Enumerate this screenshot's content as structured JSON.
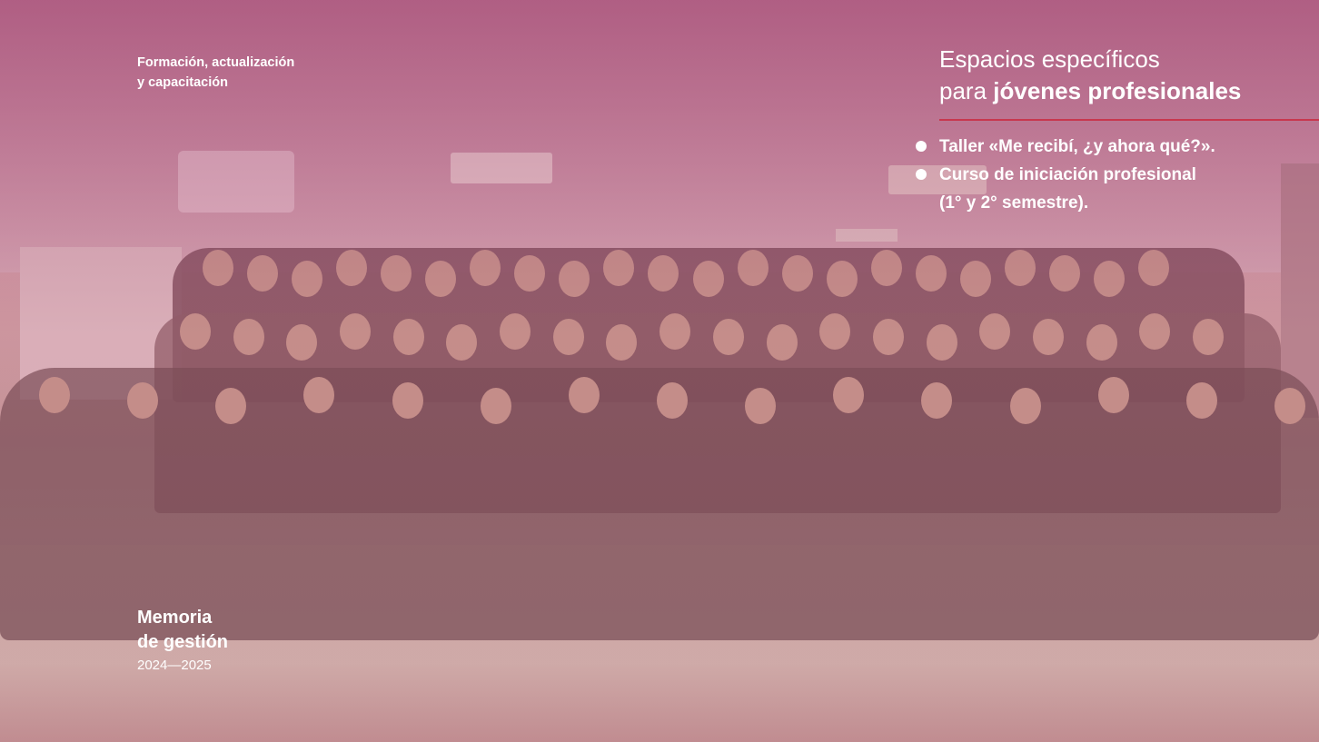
{
  "header": {
    "kicker_line1": "Formación, actualización",
    "kicker_line2": "y capacitación"
  },
  "headline": {
    "line1": "Espacios específicos",
    "line2_prefix": "para ",
    "line2_strong": "jóvenes profesionales"
  },
  "bullets": [
    "Taller «Me recibí, ¿y ahora qué?».",
    "Curso de iniciación profesional",
    "(1° y 2° semestre)."
  ],
  "footer": {
    "title_line1": "Memoria",
    "title_line2": "de gestión",
    "years": "2024—2025"
  },
  "colors": {
    "accent_rule": "#c8374e",
    "overlay_tint": "#96376a",
    "text": "#ffffff"
  }
}
